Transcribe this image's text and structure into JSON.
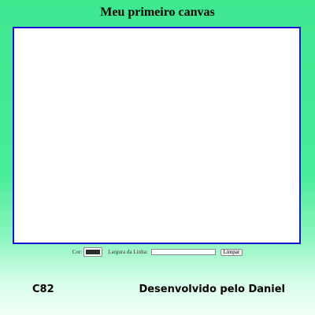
{
  "header": {
    "title": "Meu primeiro canvas"
  },
  "canvas": {
    "border_color": "#1a10d8",
    "background": "#ffffff"
  },
  "controls": {
    "color_label": "Cor:",
    "color_value": "#2d2d2d",
    "line_width_label": "Largura da Linha:",
    "line_width_value": "",
    "clear_button_label": "Limpar"
  },
  "footer": {
    "code": "C82",
    "credit": "Desenvolvido pelo Daniel"
  }
}
